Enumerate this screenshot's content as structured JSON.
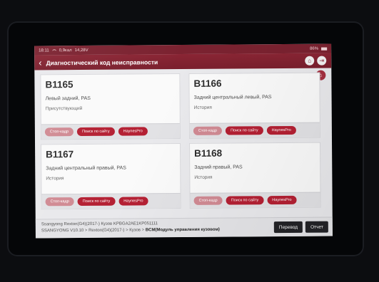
{
  "status_bar": {
    "time": "18:11",
    "network": "0,9кал",
    "voltage": "14,28V",
    "battery": "86%"
  },
  "header": {
    "title": "Диагностический код неисправности"
  },
  "cards": [
    {
      "code": "B1165",
      "description": "Левый задний, PAS",
      "status": "Присутствующий",
      "buttons": [
        "Стоп-кадр",
        "Поиск по сайту",
        "HaynesPro"
      ]
    },
    {
      "code": "B1166",
      "description": "Задний центральный левый, PAS",
      "status": "История",
      "buttons": [
        "Стоп-кадр",
        "Поиск по сайту",
        "HaynesPro"
      ]
    },
    {
      "code": "B1167",
      "description": "Задний центральный правый, PAS",
      "status": "История",
      "buttons": [
        "Стоп-кадр",
        "Поиск по сайту",
        "HaynesPro"
      ]
    },
    {
      "code": "B1168",
      "description": "Задний правый, PAS",
      "status": "История",
      "buttons": [
        "Стоп-кадр",
        "Поиск по сайту",
        "HaynesPro"
      ]
    }
  ],
  "footer": {
    "vehicle_line": "Ssangyong  Rexton(G4)(2017-) Кузов  KPBGA2AE1KP051111",
    "path_prefix": "SSANGYONG V10.10 > Rexton(G4)(2017-) > Кузов > ",
    "path_module": "BCM(Модуль управления кузовом)",
    "translate_label": "Перевод",
    "report_label": "Отчет"
  },
  "colors": {
    "accent": "#8a2534",
    "button_active": "#b42033",
    "button_disabled": "#d08a93"
  },
  "icons": [
    "back-arrow-icon",
    "home-icon",
    "exit-icon",
    "wifi-icon",
    "battery-icon"
  ]
}
